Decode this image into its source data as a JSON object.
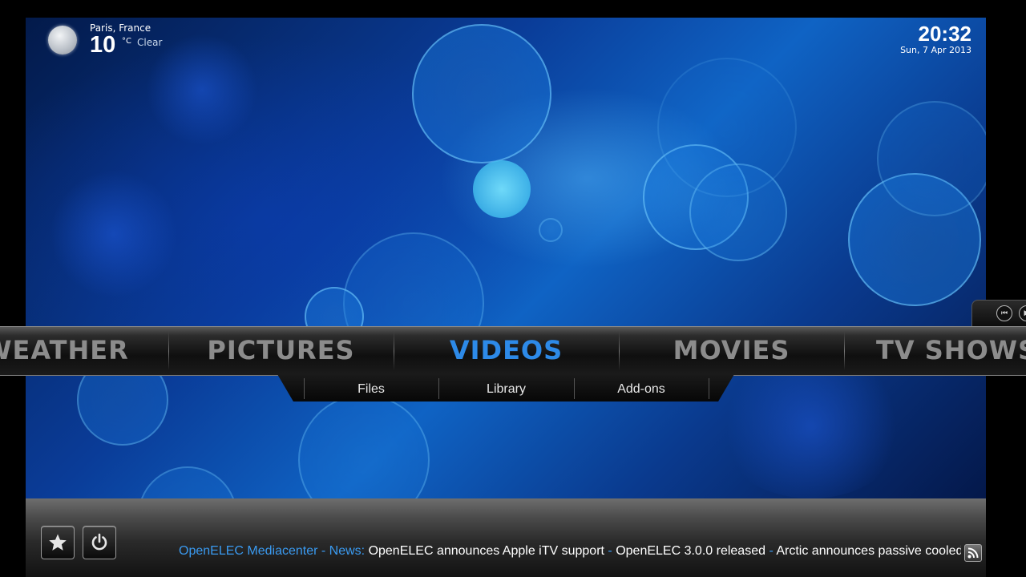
{
  "weather": {
    "location": "Paris, France",
    "temperature": "10",
    "unit": "°C",
    "condition": "Clear",
    "icon": "moon-icon"
  },
  "clock": {
    "time": "20:32",
    "date": "Sun, 7 Apr 2013"
  },
  "player_controls": {
    "icons": [
      "skip-back-icon",
      "play-icon"
    ]
  },
  "menu": {
    "items": [
      "WEATHER",
      "PICTURES",
      "VIDEOS",
      "MOVIES",
      "TV SHOWS"
    ],
    "active": "VIDEOS"
  },
  "submenu": {
    "items": [
      "Files",
      "Library",
      "Add-ons"
    ]
  },
  "bottom_buttons": {
    "favourites_icon": "star-icon",
    "power_icon": "power-icon"
  },
  "ticker": {
    "source": "OpenELEC Mediacenter",
    "separator": " - ",
    "category": "News:",
    "headlines": [
      "OpenELEC announces Apple iTV support",
      "OpenELEC 3.0.0 released",
      "Arctic announces passive cooled Sy"
    ],
    "rss_icon": "rss-icon"
  },
  "colors": {
    "accent": "#2d8ae8",
    "menu_inactive": "#8c8c8c",
    "ticker_blue": "#3a9af0"
  }
}
